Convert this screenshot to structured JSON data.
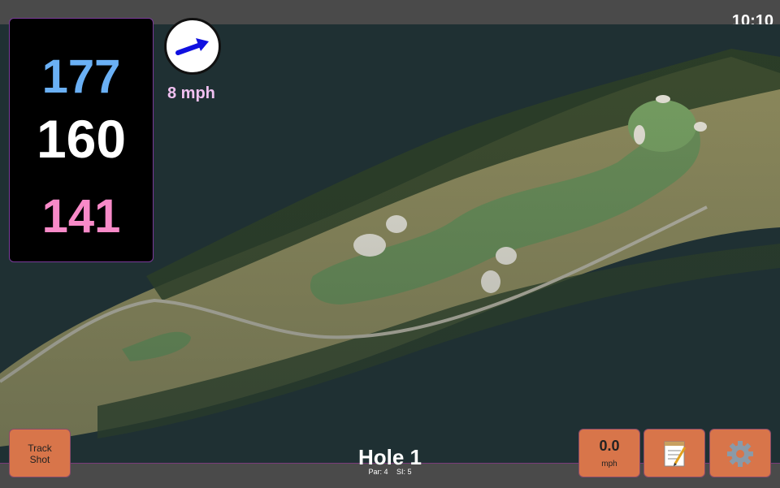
{
  "status": {
    "time": "10:10"
  },
  "distances": {
    "back": "177",
    "center": "160",
    "front": "141"
  },
  "wind": {
    "speed": "8 mph",
    "icon": "wind-direction-arrow-icon"
  },
  "hole": {
    "title": "Hole 1",
    "par": "Par: 4",
    "stroke_index": "SI: 5"
  },
  "buttons": {
    "track_shot_line1": "Track",
    "track_shot_line2": "Shot",
    "speed_value": "0.0",
    "speed_unit": "mph",
    "notes_icon": "notepad-icon",
    "settings_icon": "gear-icon"
  },
  "colors": {
    "back_distance": "#6ab0f5",
    "center_distance": "#ffffff",
    "front_distance": "#f88ac8",
    "wind_text": "#f0c0f0",
    "button": "#d8754a",
    "bar": "#4a4a4a"
  }
}
